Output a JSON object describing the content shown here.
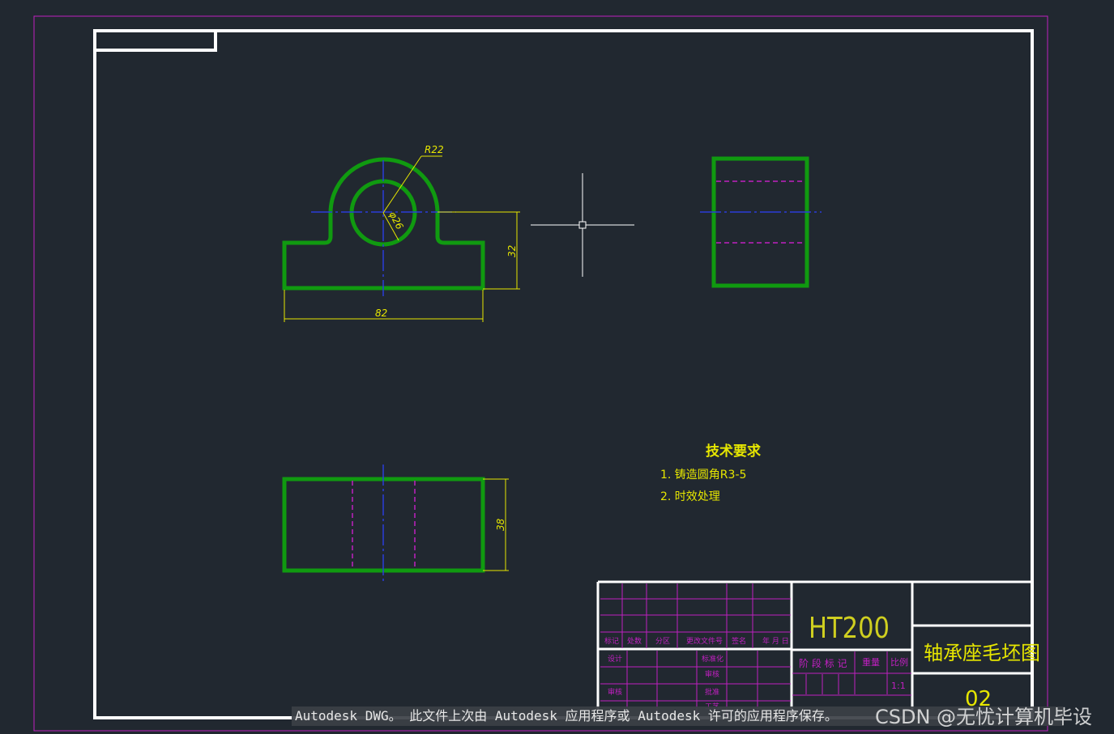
{
  "colors": {
    "background": "#212830",
    "part_outline": "#109a10",
    "dimension": "#e6e600",
    "centerline": "#2a3cd8",
    "hidden_line": "#c020c0",
    "frame": "#ffffff",
    "table_grid": "#c020c0"
  },
  "drawing": {
    "dimensions": {
      "radius": "R22",
      "diameter": "φ26",
      "height_front": "32",
      "width_front": "82",
      "height_top": "38"
    },
    "tech_requirements": {
      "title": "技术要求",
      "item1": "1. 铸造圆角R3-5",
      "item2": "2. 时效处理"
    }
  },
  "title_block": {
    "headers": {
      "mark": "标记",
      "count": "处数",
      "zone": "分区",
      "change_doc": "更改文件号",
      "sign": "签名",
      "date": "年 月 日"
    },
    "rows": {
      "design": "设计",
      "standardize": "标准化",
      "review": "审核",
      "process": "工艺",
      "approve": "批准"
    },
    "material": "HT200",
    "stage_mark": "阶 段 标 记",
    "weight": "重量",
    "scale_label": "比例",
    "scale_value": "1:1",
    "part_name": "轴承座毛坯图",
    "drawing_number": "02"
  },
  "overlay": {
    "notice": "Autodesk DWG。  此文件上次由 Autodesk 应用程序或 Autodesk 许可的应用程序保存。",
    "watermark": "CSDN @无忧计算机毕设"
  }
}
